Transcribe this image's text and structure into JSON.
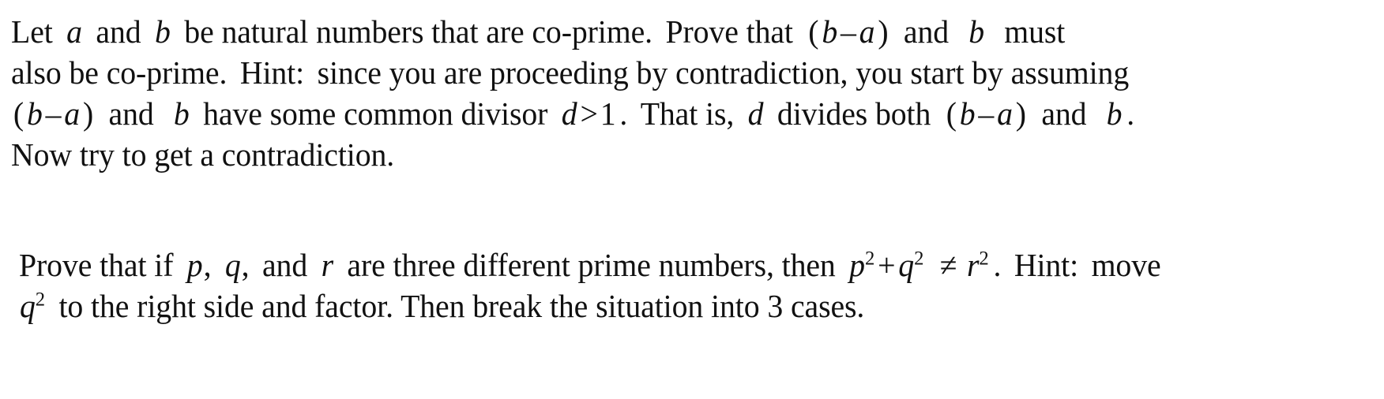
{
  "document": {
    "background_color": "#ffffff",
    "text_color": "#111111",
    "problems": [
      {
        "id": "problem-1",
        "lines": [
          {
            "id": "p1-line-1",
            "text": "Let  a  and  b  be natural numbers that are co-prime.  Prove that  (b – a)  and   b   must",
            "tokens": [
              {
                "t": "Let",
                "k": "text"
              },
              {
                "t": "a",
                "k": "var"
              },
              {
                "t": "and",
                "k": "text"
              },
              {
                "t": "b",
                "k": "var"
              },
              {
                "t": "be natural numbers that are co-prime.",
                "k": "text"
              },
              {
                "t": "Prove that",
                "k": "text"
              },
              {
                "t": "(b – a)",
                "k": "expr"
              },
              {
                "t": "and",
                "k": "text"
              },
              {
                "t": "b",
                "k": "var"
              },
              {
                "t": "must",
                "k": "text"
              }
            ]
          },
          {
            "id": "p1-line-2",
            "text": "also be co-prime.  Hint:  since you are proceeding by contradiction, you start by assuming"
          },
          {
            "id": "p1-line-3",
            "text": "(b – a)  and   b  have some common divisor  d > 1 .  That is,  d  divides both  (b – a)  and   b ."
          },
          {
            "id": "p1-line-4",
            "text": "Now try to get a contradiction."
          }
        ],
        "segments": {
          "l1_lead": "Let",
          "l1_var_a": "a",
          "l1_and1": "and",
          "l1_var_b": "b",
          "l1_mid": "be natural numbers that are co-prime.",
          "l1_prove": "Prove that",
          "l1_paren_open": "(",
          "l1_b2": "b",
          "l1_minus": "–",
          "l1_a2": "a",
          "l1_paren_close": ")",
          "l1_and2": "and",
          "l1_b3": "b",
          "l1_must": "must",
          "l2_text": "also be co-prime.",
          "l2_hint": "Hint:",
          "l2_rest": "since you are proceeding by contradiction, you start by assuming",
          "l3_paren_open": "(",
          "l3_b1": "b",
          "l3_minus": "–",
          "l3_a1": "a",
          "l3_paren_close": ")",
          "l3_and1": "and",
          "l3_b2": "b",
          "l3_have": "have some common divisor",
          "l3_d1": "d",
          "l3_gt": ">",
          "l3_one": "1",
          "l3_period1": ".",
          "l3_thatis": "That is,",
          "l3_d2": "d",
          "l3_divides": "divides both",
          "l3_paren_open2": "(",
          "l3_b3": "b",
          "l3_minus2": "–",
          "l3_a2": "a",
          "l3_paren_close2": ")",
          "l3_and2": "and",
          "l3_b4": "b",
          "l3_period2": ".",
          "l4_text": "Now try to get a contradiction."
        }
      },
      {
        "id": "problem-2",
        "lines": [
          {
            "id": "p2-line-1",
            "text": "Prove that if  p,  q,  and  r  are three different prime numbers, then  p² + q²  ≠  r² .  Hint:  move"
          },
          {
            "id": "p2-line-2",
            "text": "q²  to the right side and factor.  Then break the situation into 3 cases."
          }
        ],
        "segments": {
          "l1_lead": "Prove that if",
          "l1_p": "p",
          "l1_comma1": ",",
          "l1_q": "q",
          "l1_comma2": ",",
          "l1_and": "and",
          "l1_r": "r",
          "l1_mid": "are three different prime numbers, then",
          "l1_p2": "p",
          "l1_sup_p": "2",
          "l1_plus": "+",
          "l1_q2": "q",
          "l1_sup_q": "2",
          "l1_neq": "≠",
          "l1_r2": "r",
          "l1_sup_r": "2",
          "l1_period": ".",
          "l1_hint": "Hint:",
          "l1_move": "move",
          "l2_q": "q",
          "l2_sup_q": "2",
          "l2_rest": "to the right side and factor.  Then break the situation into 3 cases."
        }
      }
    ]
  }
}
